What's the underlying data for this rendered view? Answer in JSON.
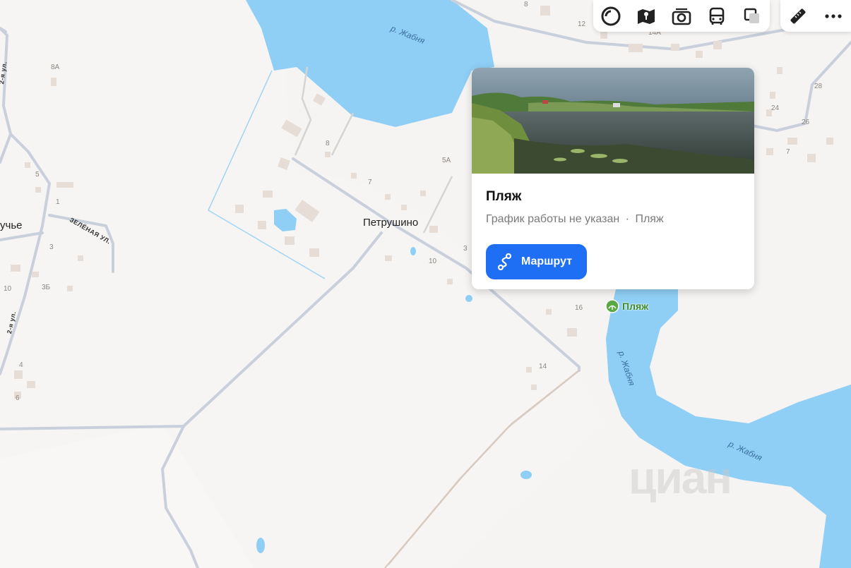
{
  "map": {
    "village_label": "Петрушино",
    "partial_village_label": "учье",
    "river_labels": [
      "р. Жабня",
      "р. Жабня",
      "р. Жабня"
    ],
    "street_labels": [
      "2-я ул.",
      "2-я ул.",
      "ЗЕЛЁНАЯ УЛ."
    ],
    "house_numbers": [
      "8",
      "12",
      "14А",
      "8А",
      "28",
      "24",
      "26",
      "7",
      "8",
      "5А",
      "7",
      "5",
      "1",
      "3",
      "10",
      "3Б",
      "4",
      "6",
      "3",
      "10",
      "16",
      "14"
    ],
    "poi_label": "Пляж",
    "watermark": "циан"
  },
  "toolbar": {
    "group1": [
      "layers-icon",
      "map-guide-icon",
      "panorama-camera-icon",
      "transport-bus-icon",
      "map-style-icon"
    ],
    "group2": [
      "ruler-icon",
      "more-icon"
    ]
  },
  "card": {
    "title": "Пляж",
    "hours": "График работы не указан",
    "separator": "·",
    "category": "Пляж",
    "route_label": "Маршрут"
  },
  "colors": {
    "water": "#8fcff5",
    "accent": "#1f6ff5",
    "road": "#c9d0dc",
    "building": "#e6ded6",
    "poi_green": "#5aa844"
  }
}
